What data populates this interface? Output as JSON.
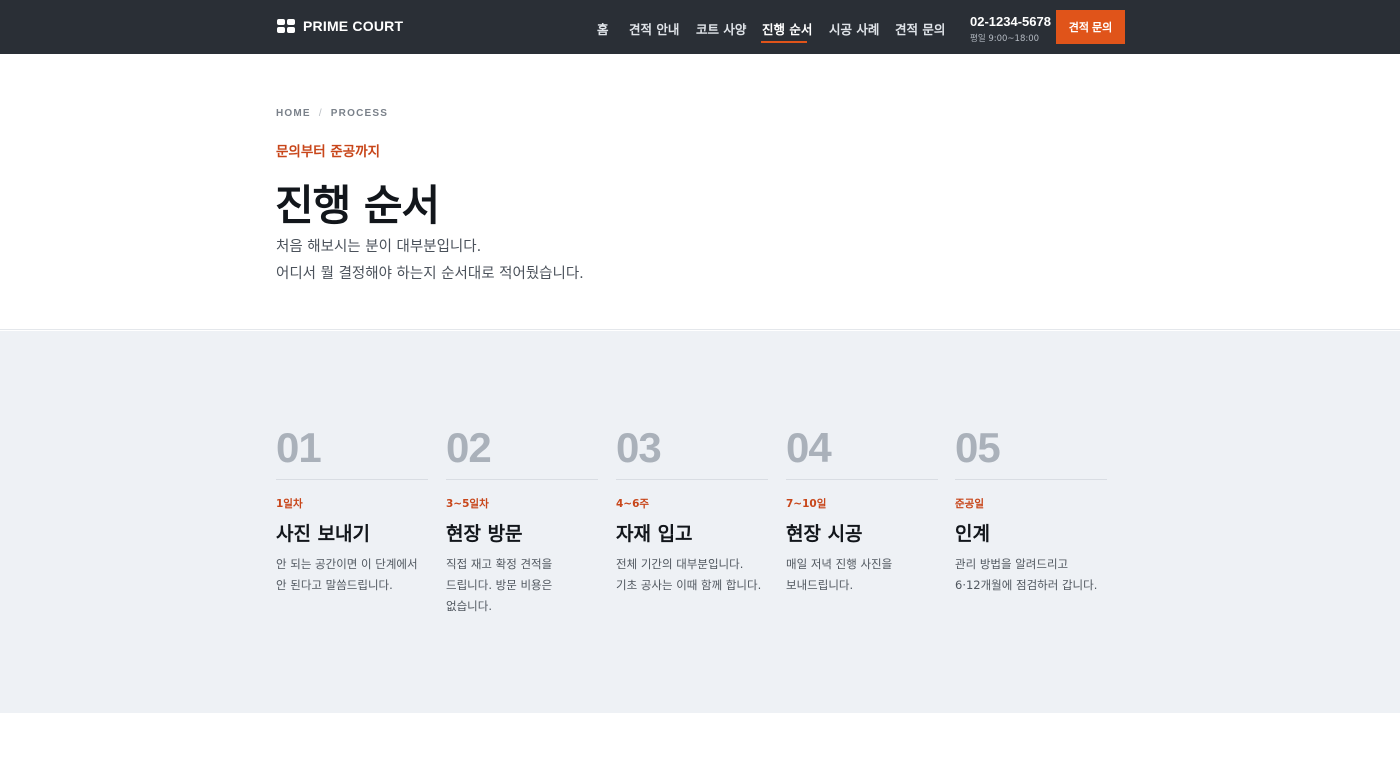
{
  "header": {
    "brand": "PRIME COURT",
    "nav": [
      {
        "label": "홈"
      },
      {
        "label": "견적 안내"
      },
      {
        "label": "코트 사양"
      },
      {
        "label": "진행 순서"
      },
      {
        "label": "시공 사례"
      },
      {
        "label": "견적 문의"
      }
    ],
    "active_nav": "진행 순서",
    "phone": "02-1234-5678",
    "hours": "평일 9:00~18:00",
    "cta_label": "견적 문의"
  },
  "hero": {
    "breadcrumb": [
      "HOME",
      "/",
      "PROCESS"
    ],
    "eyebrow": "문의부터 준공까지",
    "title": "진행 순서",
    "lead": [
      "처음 해보시는 분이 대부분입니다.",
      "어디서 뭘 결정해야 하는지 순서대로 적어뒀습니다."
    ]
  },
  "steps": [
    {
      "num": "01",
      "when": "1일차",
      "title": "사진 보내기",
      "desc": [
        "안 되는 공간이면 이 단계에서",
        "안 된다고 말씀드립니다."
      ]
    },
    {
      "num": "02",
      "when": "3~5일차",
      "title": "현장 방문",
      "desc": [
        "직접 재고 확정 견적을",
        "드립니다. 방문 비용은",
        "없습니다."
      ]
    },
    {
      "num": "03",
      "when": "4~6주",
      "title": "자재 입고",
      "desc": [
        "전체 기간의 대부분입니다.",
        "기초 공사는 이때 함께 합니다."
      ]
    },
    {
      "num": "04",
      "when": "7~10일",
      "title": "현장 시공",
      "desc": [
        "매일 저녁 진행 사진을",
        "보내드립니다."
      ]
    },
    {
      "num": "05",
      "when": "준공일",
      "title": "인계",
      "desc": [
        "관리 방법을 알려드리고",
        "6·12개월에 점검하러 갑니다."
      ]
    }
  ],
  "colors": {
    "header_bg": "#2a2f36",
    "accent": "#e0541a",
    "section_bg": "#eef1f5"
  }
}
